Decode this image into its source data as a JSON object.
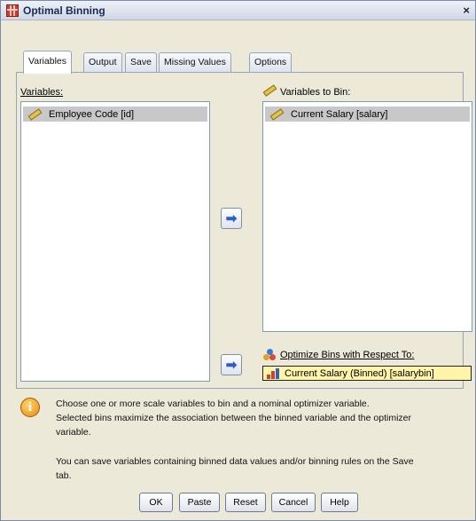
{
  "window": {
    "title": "Optimal Binning",
    "close_glyph": "×"
  },
  "tabs": [
    {
      "label": "Variables",
      "active": true
    },
    {
      "label": "Output",
      "active": false
    },
    {
      "label": "Save",
      "active": false
    },
    {
      "label": "Missing Values",
      "active": false
    },
    {
      "label": "Options",
      "active": false
    }
  ],
  "variables": {
    "label": "Variables:",
    "items": [
      {
        "label": "Employee Code [id]",
        "icon": "scale-ruler-icon",
        "selected": true
      }
    ]
  },
  "bin_variables": {
    "label": "Variables to Bin:",
    "items": [
      {
        "label": "Current Salary [salary]",
        "icon": "scale-ruler-icon",
        "selected": true
      }
    ]
  },
  "optimize": {
    "label": "Optimize Bins with Respect To:",
    "value": "Current Salary (Binned) [salarybin]",
    "icon": "ordinal-bar-icon"
  },
  "move_buttons": [
    {
      "glyph": "➡",
      "icon": "move-arrow-icon"
    },
    {
      "glyph": "➡",
      "icon": "move-arrow-icon"
    }
  ],
  "info": {
    "paragraph1": [
      "Choose one or more scale variables to bin and a nominal optimizer variable.",
      "Selected bins maximize the association between the binned variable and the optimizer",
      "variable."
    ],
    "paragraph2": [
      "You can save variables containing binned data values and/or binning rules on the Save",
      "tab."
    ]
  },
  "buttons": {
    "ok": "OK",
    "paste": "Paste",
    "reset": "Reset",
    "cancel": "Cancel",
    "help": "Help"
  },
  "colors": {
    "selection": "#c8c8c8",
    "optimizer_field": "#fff4a8",
    "arrow": "#2a5ec8"
  }
}
